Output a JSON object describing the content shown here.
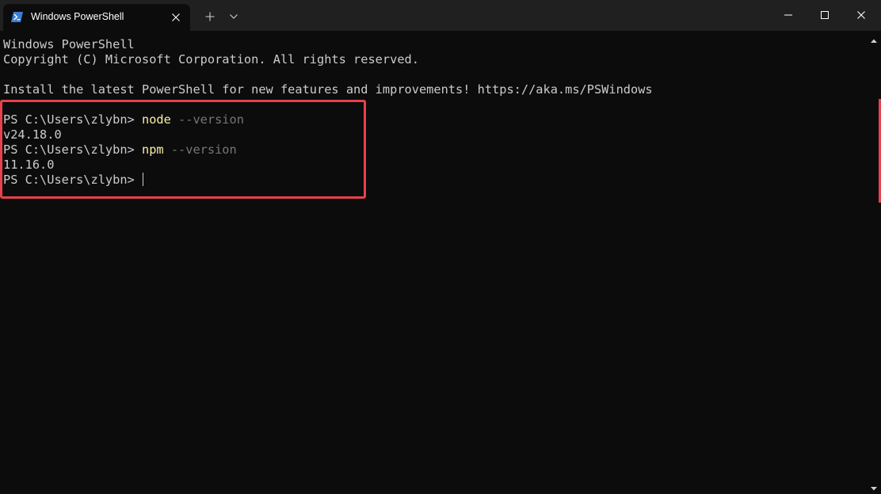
{
  "window": {
    "tab_title": "Windows PowerShell",
    "tab_icon": "powershell-icon"
  },
  "colors": {
    "background": "#0c0c0c",
    "titlebar": "#202020",
    "text": "#cccccc",
    "command": "#f9f1a5",
    "parameter": "#767676",
    "highlight": "#e8414b"
  },
  "terminal": {
    "header": {
      "line1": "Windows PowerShell",
      "line2": "Copyright (C) Microsoft Corporation. All rights reserved.",
      "line4": "Install the latest PowerShell for new features and improvements! https://aka.ms/PSWindows"
    },
    "session": [
      {
        "prompt": "PS C:\\Users\\zlybn> ",
        "command": "node",
        "args": " --version",
        "output": "v24.18.0"
      },
      {
        "prompt": "PS C:\\Users\\zlybn> ",
        "command": "npm",
        "args": " --version",
        "output": "11.16.0"
      }
    ],
    "current_prompt": "PS C:\\Users\\zlybn> "
  }
}
